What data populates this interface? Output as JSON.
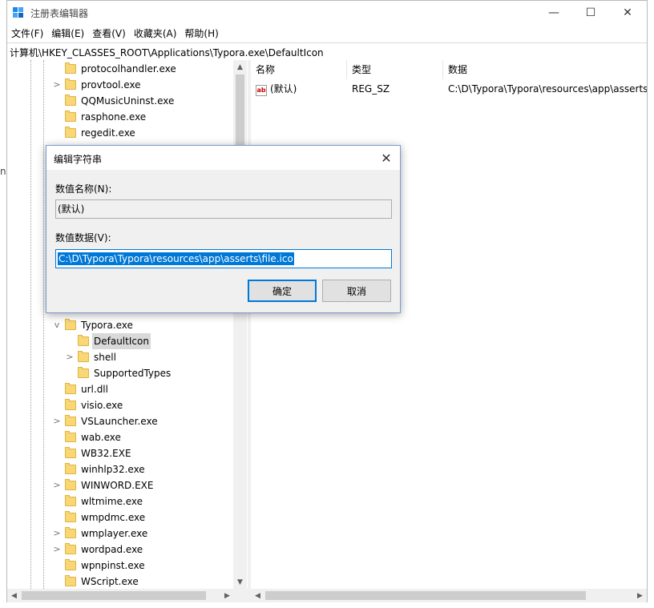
{
  "window": {
    "title": "注册表编辑器",
    "minimize": "—",
    "maximize": "☐",
    "close": "✕"
  },
  "menu": [
    "文件(F)",
    "编辑(E)",
    "查看(V)",
    "收藏夹(A)",
    "帮助(H)"
  ],
  "address": "计算机\\HKEY_CLASSES_ROOT\\Applications\\Typora.exe\\DefaultIcon",
  "tree": {
    "items_top": [
      {
        "label": "protocolhandler.exe",
        "expandable": false
      },
      {
        "label": "provtool.exe",
        "expandable": true
      },
      {
        "label": "QQMusicUninst.exe",
        "expandable": false
      },
      {
        "label": "rasphone.exe",
        "expandable": false
      },
      {
        "label": "regedit.exe",
        "expandable": false
      }
    ],
    "typora": {
      "label": "Typora.exe",
      "expanded": true
    },
    "typora_children": [
      {
        "label": "DefaultIcon",
        "expandable": false,
        "selected": true
      },
      {
        "label": "shell",
        "expandable": true
      },
      {
        "label": "SupportedTypes",
        "expandable": false
      }
    ],
    "items_bottom": [
      {
        "label": "url.dll",
        "expandable": false
      },
      {
        "label": "visio.exe",
        "expandable": false
      },
      {
        "label": "VSLauncher.exe",
        "expandable": true
      },
      {
        "label": "wab.exe",
        "expandable": false
      },
      {
        "label": "WB32.EXE",
        "expandable": false
      },
      {
        "label": "winhlp32.exe",
        "expandable": false
      },
      {
        "label": "WINWORD.EXE",
        "expandable": true
      },
      {
        "label": "wltmime.exe",
        "expandable": false
      },
      {
        "label": "wmpdmc.exe",
        "expandable": false
      },
      {
        "label": "wmplayer.exe",
        "expandable": true
      },
      {
        "label": "wordpad.exe",
        "expandable": true
      },
      {
        "label": "wpnpinst.exe",
        "expandable": false
      },
      {
        "label": "WScript.exe",
        "expandable": false
      }
    ]
  },
  "list": {
    "columns": [
      "名称",
      "类型",
      "数据"
    ],
    "rows": [
      {
        "name": "(默认)",
        "type": "REG_SZ",
        "data": "C:\\D\\Typora\\Typora\\resources\\app\\asserts\\file.ico"
      }
    ],
    "icon": "ab"
  },
  "dialog": {
    "title": "编辑字符串",
    "close": "✕",
    "name_label": "数值名称(N):",
    "name_value": "(默认)",
    "data_label": "数值数据(V):",
    "data_value": "C:\\D\\Typora\\Typora\\resources\\app\\asserts\\file.ico",
    "ok": "确定",
    "cancel": "取消"
  },
  "edge_text": "nc",
  "colors": {
    "accent": "#0078d7",
    "folder": "#f8d775"
  }
}
